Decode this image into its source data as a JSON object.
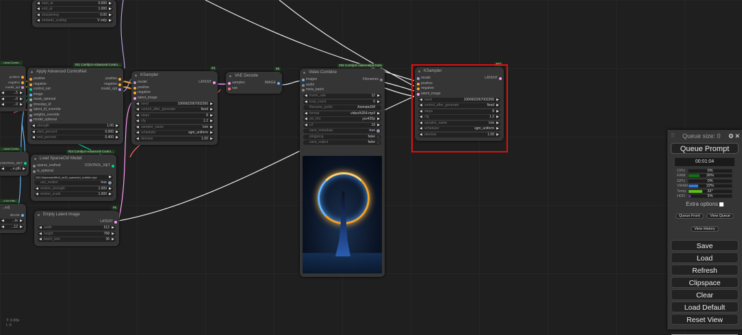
{
  "colors": {
    "accent_selected": "#e01010",
    "model": "#b39ddb",
    "conditioning": "#ffa931",
    "latent": "#ff9cf9",
    "image": "#64b5f6",
    "vae": "#ff6e6e",
    "control_net": "#00d78d",
    "mask": "#81c784",
    "misc": "#888888"
  },
  "nodes": {
    "top": {
      "title": "",
      "badge": "",
      "inputs": [],
      "outputs": [],
      "widgets": [
        {
          "label": "start_at",
          "value": "0.000"
        },
        {
          "label": "end_at",
          "value": "1.000"
        },
        {
          "label": "sharpening",
          "value": "0.00"
        },
        {
          "label": "embeds_scaling",
          "value": "V only"
        }
      ]
    },
    "leftcn": {
      "title": "",
      "badge": "...nced-Contro...",
      "inputs": [],
      "outputs": [
        {
          "name": "positive",
          "type": "conditioning"
        },
        {
          "name": "negative",
          "type": "conditioning"
        },
        {
          "name": "model_opt",
          "type": "model"
        }
      ],
      "widgets": [
        {
          "label": "",
          "value": "...5"
        },
        {
          "label": "",
          "value": "...0"
        },
        {
          "label": "",
          "value": "...0"
        }
      ]
    },
    "acn": {
      "title": "Apply Advanced ControlNet",
      "badge": "#21 ComfyUI-Advanced-Contro...",
      "inputs": [
        {
          "name": "positive",
          "type": "conditioning"
        },
        {
          "name": "negative",
          "type": "conditioning"
        },
        {
          "name": "control_net",
          "type": "control_net"
        },
        {
          "name": "image",
          "type": "image"
        },
        {
          "name": "mask_optional",
          "type": "mask"
        },
        {
          "name": "timestep_kf",
          "type": "misc"
        },
        {
          "name": "latent_kf_override",
          "type": "misc"
        },
        {
          "name": "weights_override",
          "type": "misc"
        },
        {
          "name": "model_optional",
          "type": "model"
        }
      ],
      "outputs": [
        {
          "name": "positive",
          "type": "conditioning"
        },
        {
          "name": "negative",
          "type": "conditioning"
        },
        {
          "name": "model_opt",
          "type": "model"
        }
      ],
      "widgets": [
        {
          "label": "strength",
          "value": "1.00"
        },
        {
          "label": "start_percent",
          "value": "0.000"
        },
        {
          "label": "end_percent",
          "value": "0.400"
        }
      ]
    },
    "ks3": {
      "title": "KSampler",
      "badge": "#3",
      "inputs": [
        {
          "name": "model",
          "type": "model"
        },
        {
          "name": "positive",
          "type": "conditioning"
        },
        {
          "name": "negative",
          "type": "conditioning"
        },
        {
          "name": "latent_image",
          "type": "latent"
        }
      ],
      "outputs": [
        {
          "name": "LATENT",
          "type": "latent"
        }
      ],
      "widgets": [
        {
          "label": "seed",
          "value": "1066602067002266"
        },
        {
          "label": "control_after_generate",
          "value": "fixed"
        },
        {
          "label": "steps",
          "value": "8"
        },
        {
          "label": "cfg",
          "value": "1.2"
        },
        {
          "label": "sampler_name",
          "value": "lcm"
        },
        {
          "label": "scheduler",
          "value": "sgm_uniform"
        },
        {
          "label": "denoise",
          "value": "1.00"
        }
      ]
    },
    "vae": {
      "title": "VAE Decode",
      "badge": "#8",
      "inputs": [
        {
          "name": "samples",
          "type": "latent"
        },
        {
          "name": "vae",
          "type": "vae"
        }
      ],
      "outputs": [
        {
          "name": "IMAGE",
          "type": "image"
        }
      ],
      "widgets": []
    },
    "vc": {
      "title": "Video Combine",
      "badge": "#26 ComfyUI-VideoHelperSuite",
      "inputs": [
        {
          "name": "images",
          "type": "image"
        },
        {
          "name": "audio",
          "type": "misc"
        },
        {
          "name": "meta_batch",
          "type": "misc"
        }
      ],
      "outputs": [
        {
          "name": "Filenames",
          "type": "misc"
        }
      ],
      "widgets": [
        {
          "label": "frame_rate",
          "value": "12"
        },
        {
          "label": "loop_count",
          "value": "0"
        },
        {
          "label": "filename_prefix",
          "value": "AnimateDiff",
          "plain": true
        },
        {
          "label": "format",
          "value": "video/h264-mp4"
        },
        {
          "label": "pix_fmt",
          "value": "yuv420p"
        },
        {
          "label": "crf",
          "value": "19"
        },
        {
          "label": "save_metadata",
          "value": "true",
          "toggle": "on"
        },
        {
          "label": "pingpong",
          "value": "false",
          "toggle": "off"
        },
        {
          "label": "save_output",
          "value": "false",
          "toggle": "off"
        }
      ]
    },
    "ks27": {
      "title": "KSampler",
      "badge": "#27",
      "inputs": [
        {
          "name": "model",
          "type": "model"
        },
        {
          "name": "positive",
          "type": "conditioning"
        },
        {
          "name": "negative",
          "type": "conditioning"
        },
        {
          "name": "latent_image",
          "type": "latent"
        }
      ],
      "outputs": [
        {
          "name": "LATENT",
          "type": "latent"
        }
      ],
      "widgets": [
        {
          "label": "seed",
          "value": "1066602067002266"
        },
        {
          "label": "control_after_generate",
          "value": "fixed"
        },
        {
          "label": "steps",
          "value": "8"
        },
        {
          "label": "cfg",
          "value": "1.2"
        },
        {
          "label": "sampler_name",
          "value": "lcm"
        },
        {
          "label": "scheduler",
          "value": "sgm_uniform"
        },
        {
          "label": "denoise",
          "value": "1.00"
        }
      ]
    },
    "leftcn2": {
      "title": "",
      "badge": "...nced-Contro...",
      "inputs": [],
      "outputs": [
        {
          "name": "...CONTROL_NET",
          "type": "control_net"
        }
      ],
      "widgets": [
        {
          "label": "",
          "value": "...e.pth"
        }
      ]
    },
    "sparse": {
      "title": "Load SparseCtrl Model",
      "badge": "#24 ComfyUI-Advanced-Contro...",
      "inputs": [
        {
          "name": "sparse_method",
          "type": "misc"
        },
        {
          "name": "is_optional",
          "type": "misc"
        }
      ],
      "outputs": [
        {
          "name": "CONTROL_NET",
          "type": "control_net"
        }
      ],
      "widgets": [
        {
          "label": "",
          "value": "SD1.5\\animatediff\\v3_sd15_sparsectrl_scribble.ckpt"
        },
        {
          "label": "use_motion",
          "value": "true",
          "toggle": "on"
        },
        {
          "label": "motion_strength",
          "value": "1.000"
        },
        {
          "label": "motion_scale",
          "value": "1.000"
        }
      ]
    },
    "leftimg": {
      "title": "...ed)",
      "badge": "...s for Infer...",
      "inputs": [],
      "outputs": [
        {
          "name": "IMAGE",
          "type": "image"
        }
      ],
      "widgets": [
        {
          "label": "",
          "value": "...le"
        },
        {
          "label": "",
          "value": "...12"
        }
      ]
    },
    "empty": {
      "title": "Empty Latent Image",
      "badge": "#5",
      "inputs": [],
      "outputs": [
        {
          "name": "LATENT",
          "type": "latent"
        }
      ],
      "widgets": [
        {
          "label": "width",
          "value": "512"
        },
        {
          "label": "height",
          "value": "768"
        },
        {
          "label": "batch_size",
          "value": "36"
        }
      ]
    }
  },
  "queue": {
    "size_label": "Queue size: 0",
    "queue_prompt": "Queue Prompt",
    "timer": "00:01:04",
    "monitors": [
      {
        "label": "CPU",
        "value": "0%",
        "pct": 0,
        "color": "#1b6e1b"
      },
      {
        "label": "RAM",
        "value": "26%",
        "pct": 26,
        "color": "#137013"
      },
      {
        "label": "GPU",
        "value": "0%",
        "pct": 0,
        "color": "#1b6e1b"
      },
      {
        "label": "VRAM",
        "value": "22%",
        "pct": 22,
        "color": "#2f7ad8"
      },
      {
        "label": "Temp",
        "value": "32°",
        "pct": 32,
        "color": "#5cc11a"
      },
      {
        "label": "HDD",
        "value": "5%",
        "pct": 5,
        "color": "#8a1fb0"
      }
    ],
    "extra_options": "Extra options",
    "queue_front": "Queue Front",
    "view_queue": "View Queue",
    "view_history": "View History",
    "buttons": [
      "Save",
      "Load",
      "Refresh",
      "Clipspace",
      "Clear",
      "Load Default",
      "Reset View"
    ]
  },
  "stats": {
    "time": "T: 0.00s",
    "iter": "I: 0"
  }
}
